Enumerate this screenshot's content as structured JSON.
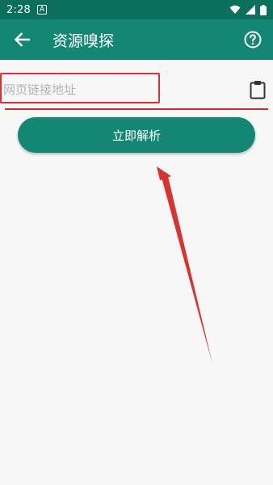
{
  "status_bar": {
    "time": "2:28",
    "notification_glyph": "A",
    "icons": [
      "wifi-icon",
      "signal-icon",
      "battery-icon"
    ]
  },
  "app_bar": {
    "title": "资源嗅探",
    "back_icon": "arrow-left-icon",
    "help_icon": "help-circle-icon"
  },
  "url_input": {
    "value": "",
    "placeholder": "网页链接地址",
    "paste_icon": "clipboard-icon"
  },
  "parse_button": {
    "label": "立即解析"
  },
  "colors": {
    "status_bar": "#0b6f5e",
    "primary": "#148774",
    "annotation_red": "#d9322f",
    "background": "#f7f7f7"
  }
}
